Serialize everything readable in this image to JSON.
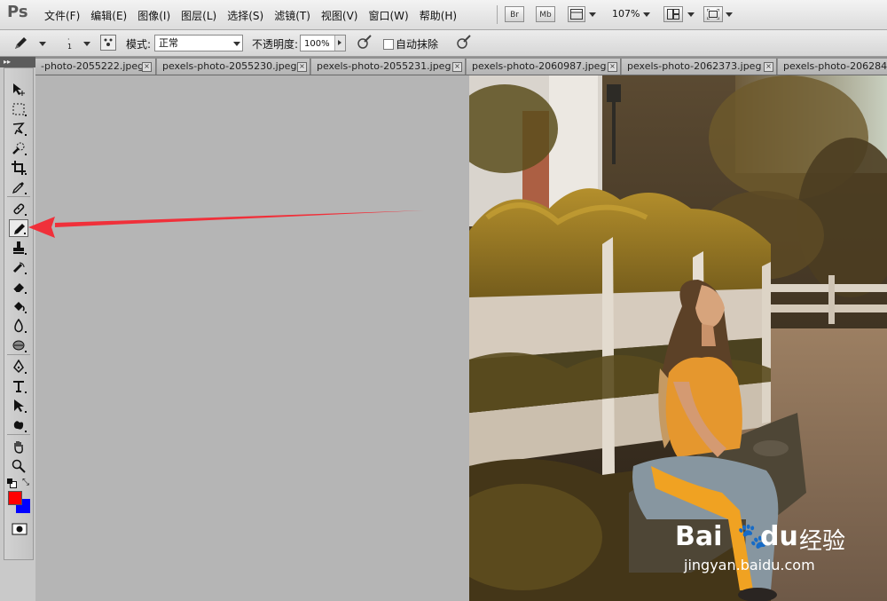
{
  "app": {
    "logo": "Ps"
  },
  "menu": {
    "items": [
      "文件(F)",
      "编辑(E)",
      "图像(I)",
      "图层(L)",
      "选择(S)",
      "滤镜(T)",
      "视图(V)",
      "窗口(W)",
      "帮助(H)"
    ],
    "buttons": {
      "bridge": "Br",
      "minibridge": "Mb"
    },
    "zoom": "107%"
  },
  "options": {
    "brush_size": "1",
    "mode_label": "模式:",
    "mode_value": "正常",
    "opacity_label": "不透明度:",
    "opacity_value": "100%",
    "auto_erase_label": "自动抹除",
    "auto_erase_checked": false
  },
  "tabs": [
    {
      "label": "-photo-2055222.jpeg"
    },
    {
      "label": "pexels-photo-2055230.jpeg"
    },
    {
      "label": "pexels-photo-2055231.jpeg"
    },
    {
      "label": "pexels-photo-2060987.jpeg"
    },
    {
      "label": "pexels-photo-2062373.jpeg"
    },
    {
      "label": "pexels-photo-206284"
    }
  ],
  "tools": {
    "active": "pencil-tool",
    "foreground_color": "#ff0000",
    "background_color": "#0000ff"
  },
  "annotation": {
    "arrow_color": "#f0303a"
  },
  "watermark": {
    "brand": "Bai",
    "brand2": "du",
    "suffix": "经验",
    "url": "jingyan.baidu.com"
  }
}
